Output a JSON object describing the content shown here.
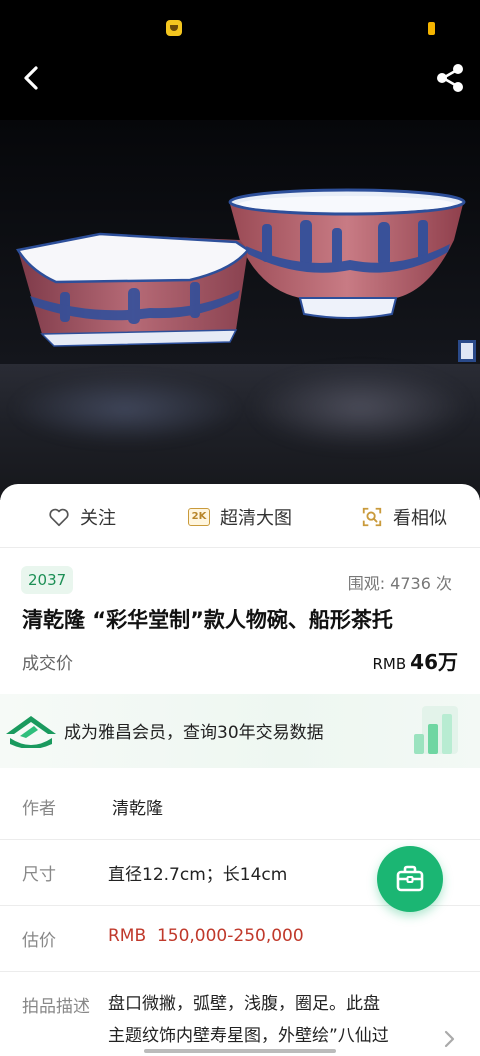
{
  "actions": {
    "follow": "关注",
    "hd_badge": "2K",
    "hd": "超清大图",
    "similar": "看相似"
  },
  "lot": {
    "number": "2037",
    "views": "围观: 4736 次",
    "title": "清乾隆 “彩华堂制”款人物碗、船形茶托",
    "price_label": "成交价",
    "price_currency": "RMB",
    "price_amount": "46万"
  },
  "member": {
    "text": "成为雅昌会员，查询30年交易数据"
  },
  "details": {
    "author_label": "作者",
    "author_value": "清乾隆",
    "size_label": "尺寸",
    "size_value": "直径12.7cm；长14cm",
    "estimate_label": "估价",
    "estimate_value": "RMB  150,000-250,000",
    "desc_label": "拍品描述",
    "desc_line1": "盘口微撇，弧壁，浅腹，圈足。此盘",
    "desc_line2": "主题纹饰内壁寿星图，外壁绘”八仙过"
  },
  "colors": {
    "accent_green": "#1bb673",
    "estimate_red": "#c0392b"
  },
  "icons": {
    "back": "back-arrow-icon",
    "share": "share-icon",
    "follow": "heart-icon",
    "similar": "scan-search-icon",
    "fab": "briefcase-icon",
    "more": "chevron-right-icon"
  }
}
